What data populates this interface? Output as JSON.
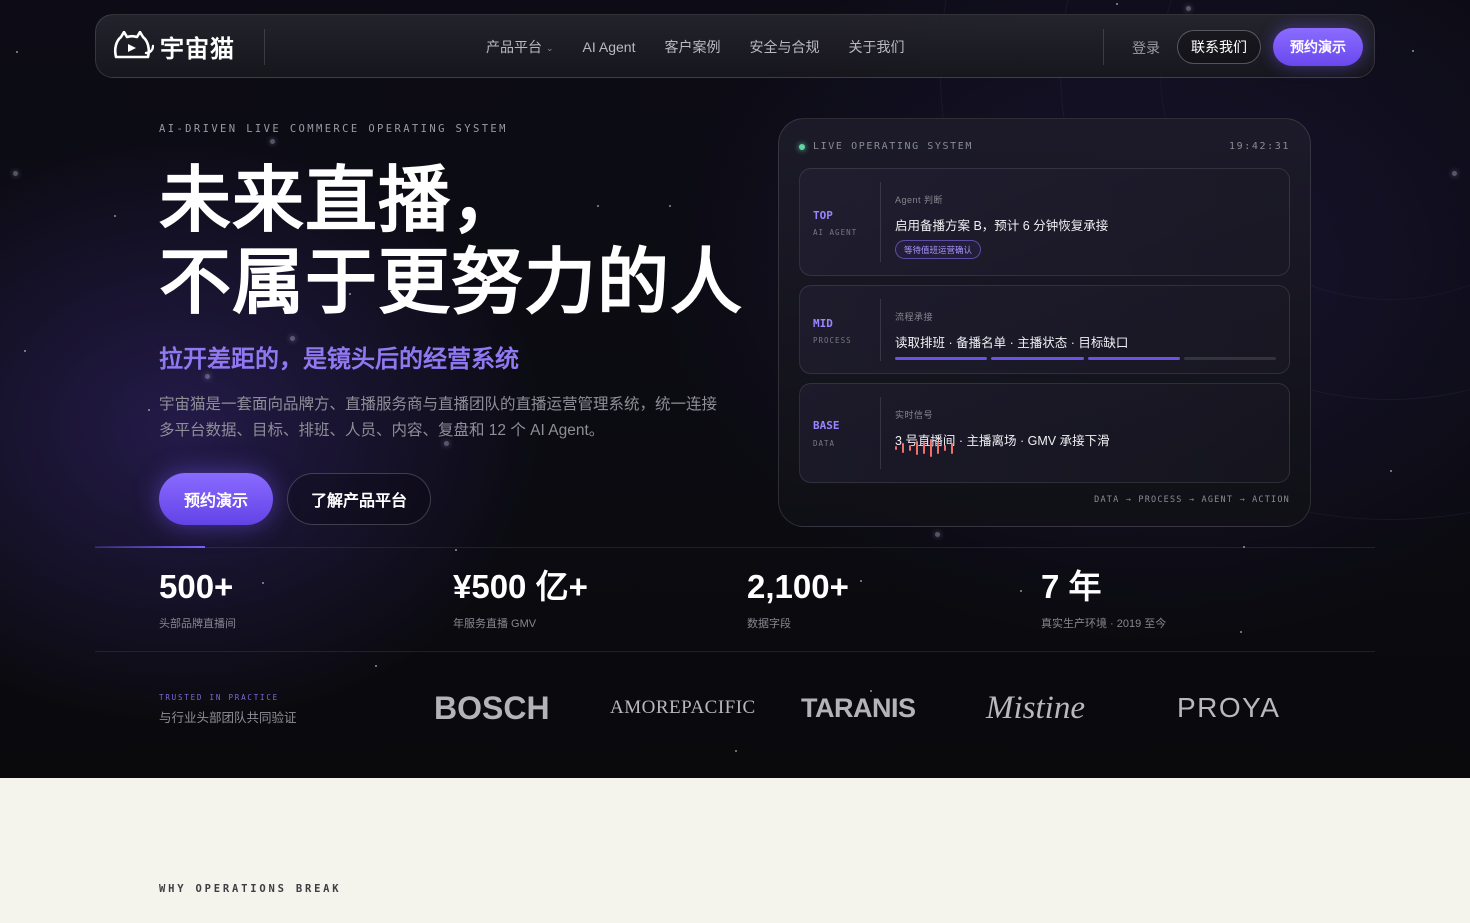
{
  "colors": {
    "accent": "#7a5cff",
    "accent_text": "#8f78f0",
    "live": "#5fd6a3",
    "signal": "#ef6f6f",
    "light_bg": "#f4f3ec"
  },
  "nav": {
    "brand": "宇宙猫",
    "links": [
      {
        "label": "产品平台",
        "has_dropdown": true
      },
      {
        "label": "AI Agent"
      },
      {
        "label": "客户案例"
      },
      {
        "label": "安全与合规"
      },
      {
        "label": "关于我们"
      }
    ],
    "login": "登录",
    "contact": "联系我们",
    "demo": "预约演示"
  },
  "hero": {
    "eyebrow": "AI-DRIVEN LIVE COMMERCE OPERATING SYSTEM",
    "headline_line1": "未来直播，",
    "headline_line2": "不属于更努力的人",
    "subhead": "拉开差距的，是镜头后的经营系统",
    "description": "宇宙猫是一套面向品牌方、直播服务商与直播团队的直播运营管理系统，统一连接多平台数据、目标、排班、人员、内容、复盘和 12 个 AI Agent。",
    "cta_primary": "预约演示",
    "cta_secondary": "了解产品平台"
  },
  "panel": {
    "title": "LIVE OPERATING SYSTEM",
    "time": "19:42:31",
    "layers": [
      {
        "tag": "TOP",
        "sub": "AI AGENT",
        "kicker": "Agent 判断",
        "main": "启用备播方案 B，预计 6 分钟恢复承接",
        "pill": "等待值班运营确认"
      },
      {
        "tag": "MID",
        "sub": "PROCESS",
        "kicker": "流程承接",
        "main": "读取排班 · 备播名单 · 主播状态 · 目标缺口",
        "progress_steps": 4,
        "progress_done": 3
      },
      {
        "tag": "BASE",
        "sub": "DATA",
        "kicker": "实时信号",
        "main": "3 号直播间 · 主播离场 · GMV 承接下滑"
      }
    ],
    "footer": "DATA → PROCESS → AGENT → ACTION"
  },
  "stats": [
    {
      "value": "500+",
      "label": "头部品牌直播间"
    },
    {
      "value": "¥500 亿+",
      "label": "年服务直播 GMV"
    },
    {
      "value": "2,100+",
      "label": "数据字段"
    },
    {
      "value": "7 年",
      "label": "真实生产环境 · 2019 至今"
    }
  ],
  "trust": {
    "kicker": "TRUSTED IN PRACTICE",
    "text": "与行业头部团队共同验证",
    "brands": [
      "BOSCH",
      "AMOREPACIFIC",
      "TARANIS",
      "Mistine",
      "PROYA"
    ]
  },
  "next_section": {
    "eyebrow": "WHY OPERATIONS BREAK"
  }
}
